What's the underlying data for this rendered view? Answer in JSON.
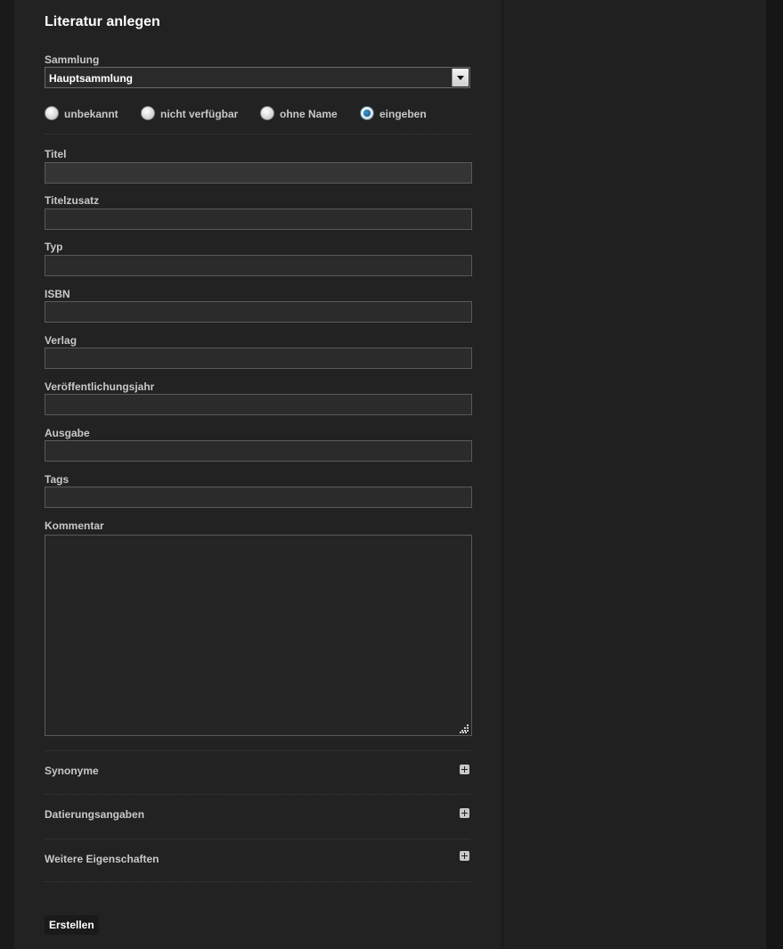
{
  "form": {
    "title": "Literatur anlegen",
    "collection": {
      "label": "Sammlung",
      "selected": "Hauptsammlung"
    },
    "name_options": [
      {
        "label": "unbekannt",
        "checked": false
      },
      {
        "label": "nicht verfügbar",
        "checked": false
      },
      {
        "label": "ohne Name",
        "checked": false
      },
      {
        "label": "eingeben",
        "checked": true
      }
    ],
    "fields": {
      "titel": {
        "label": "Titel",
        "value": ""
      },
      "titelzusatz": {
        "label": "Titelzusatz",
        "value": ""
      },
      "typ": {
        "label": "Typ",
        "value": ""
      },
      "isbn": {
        "label": "ISBN",
        "value": ""
      },
      "verlag": {
        "label": "Verlag",
        "value": ""
      },
      "jahr": {
        "label": "Veröffentlichungsjahr",
        "value": ""
      },
      "ausgabe": {
        "label": "Ausgabe",
        "value": ""
      },
      "tags": {
        "label": "Tags",
        "value": ""
      },
      "kommentar": {
        "label": "Kommentar",
        "value": ""
      }
    },
    "sections": [
      {
        "label": "Synonyme",
        "icon": "plus-square-icon"
      },
      {
        "label": "Datierungsangaben",
        "icon": "plus-square-icon"
      },
      {
        "label": "Weitere Eigenschaften",
        "icon": "plus-square-icon"
      }
    ],
    "submit_label": "Erstellen"
  },
  "colors": {
    "background": "#191919",
    "panel": "#222222",
    "input_border": "#5a5a5a",
    "text": "#c8c8c8",
    "radio_selected": "#1a6fa8"
  }
}
